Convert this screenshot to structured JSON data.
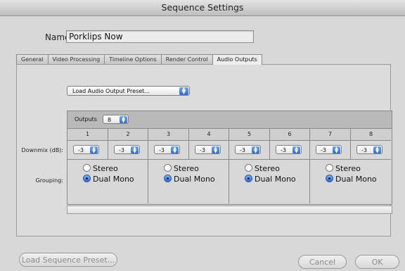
{
  "window": {
    "title": "Sequence Settings"
  },
  "name_field": {
    "label": "Name:",
    "value": "Porklips Now"
  },
  "tabs": [
    {
      "label": "General"
    },
    {
      "label": "Video Processing"
    },
    {
      "label": "Timeline Options"
    },
    {
      "label": "Render Control"
    },
    {
      "label": "Audio Outputs",
      "active": true
    }
  ],
  "preset_popup": {
    "label": "Load Audio Output Preset..."
  },
  "outputs": {
    "label": "Outputs",
    "value": "8"
  },
  "channels": [
    "1",
    "2",
    "3",
    "4",
    "5",
    "6",
    "7",
    "8"
  ],
  "downmix": {
    "label": "Downmix (dB):",
    "values": [
      "-3",
      "-3",
      "-3",
      "-3",
      "-3",
      "-3",
      "-3",
      "-3"
    ]
  },
  "grouping": {
    "label": "Grouping:",
    "options": [
      "Stereo",
      "Dual Mono"
    ],
    "groups": [
      {
        "selected": "Dual Mono"
      },
      {
        "selected": "Dual Mono"
      },
      {
        "selected": "Dual Mono"
      },
      {
        "selected": "Dual Mono"
      }
    ]
  },
  "buttons": {
    "load_sequence_preset": "Load Sequence Preset...",
    "cancel": "Cancel",
    "ok": "OK"
  },
  "colors": {
    "accent": "#2f6bd0"
  }
}
